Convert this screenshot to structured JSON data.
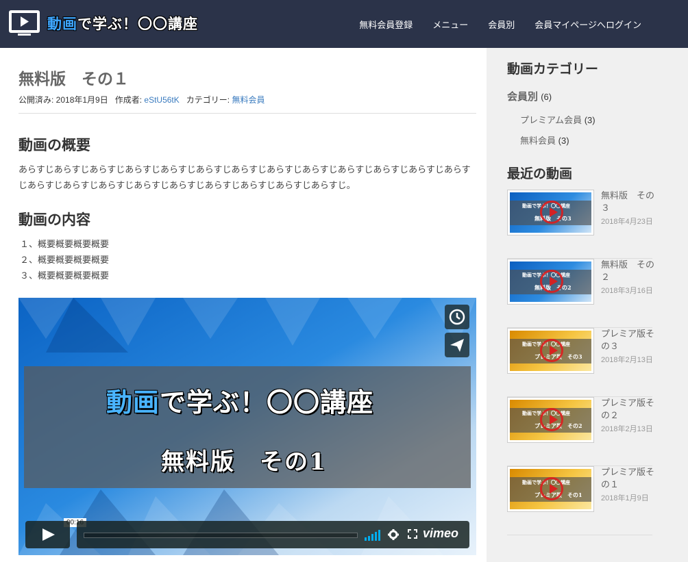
{
  "header": {
    "title_highlight": "動画",
    "title_rest": "で学ぶ！〇〇講座",
    "nav": [
      "無料会員登録",
      "メニュー",
      "会員別",
      "会員マイページへログイン"
    ]
  },
  "post": {
    "title": "無料版　その１",
    "meta_published_label": "公開済み: ",
    "meta_published_date": "2018年1月9日",
    "meta_author_label": "作成者: ",
    "meta_author": "eStU56tK",
    "meta_category_label": "カテゴリー: ",
    "meta_category": "無料会員",
    "section1_heading": "動画の概要",
    "section1_text": "あらすじあらすじあらすじあらすじあらすじあらすじあらすじあらすじあらすじあらすじあらすじあらすじあらすじあらすじあらすじあらすじあらすじあらすじあらすじあらすじあらすじあらすじ。",
    "section2_heading": "動画の内容",
    "list": [
      "１、概要概要概要概要",
      "２、概要概要概要概要",
      "３、概要概要概要概要"
    ]
  },
  "video": {
    "banner_highlight": "動画",
    "banner_rest": "で学ぶ！〇〇講座",
    "banner_sub": "無料版　その1",
    "time": "00:16",
    "progress": 0.0,
    "brand": "vimeo"
  },
  "sidebar": {
    "categories_heading": "動画カテゴリー",
    "parent_category": "会員別",
    "parent_count": "(6)",
    "children": [
      {
        "label": "プレミアム会員",
        "count": "(3)"
      },
      {
        "label": "無料会員",
        "count": "(3)"
      }
    ],
    "recent_heading": "最近の動画",
    "recent": [
      {
        "title": "無料版　その３",
        "date": "2018年4月23日",
        "theme": "blue",
        "thumb_sub": "無料版　その3"
      },
      {
        "title": "無料版　その２",
        "date": "2018年3月16日",
        "theme": "blue",
        "thumb_sub": "無料版　その2"
      },
      {
        "title": "プレミア版その３",
        "date": "2018年2月13日",
        "theme": "gold",
        "thumb_sub": "プレミア版　その3"
      },
      {
        "title": "プレミア版その２",
        "date": "2018年2月13日",
        "theme": "gold",
        "thumb_sub": "プレミア版　その2"
      },
      {
        "title": "プレミア版その１",
        "date": "2018年1月9日",
        "theme": "gold",
        "thumb_sub": "プレミア版　その1"
      }
    ],
    "thumb_title": "動画で学ぶ！〇〇講座"
  },
  "colors": {
    "header_bg": "#2b3349",
    "accent": "#3ea6ff",
    "link": "#3a7bbf"
  }
}
